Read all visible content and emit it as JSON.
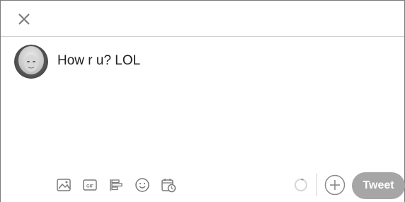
{
  "composer": {
    "close_icon": "close-icon",
    "avatar_alt": "user-avatar",
    "tweet_text": "How r u? LOL",
    "toolbar_icons": [
      "image-icon",
      "gif-icon",
      "poll-icon",
      "emoji-icon",
      "schedule-icon"
    ],
    "gif_label": "GIF",
    "tweet_button_label": "Tweet",
    "add_icon": "plus-circle-icon",
    "character_progress_icon": "character-progress-ring"
  },
  "colors": {
    "icon_gray": "#7a7a7a",
    "button_gray": "#a6a6a6",
    "text": "#222222",
    "divider": "#d0d0d0"
  }
}
